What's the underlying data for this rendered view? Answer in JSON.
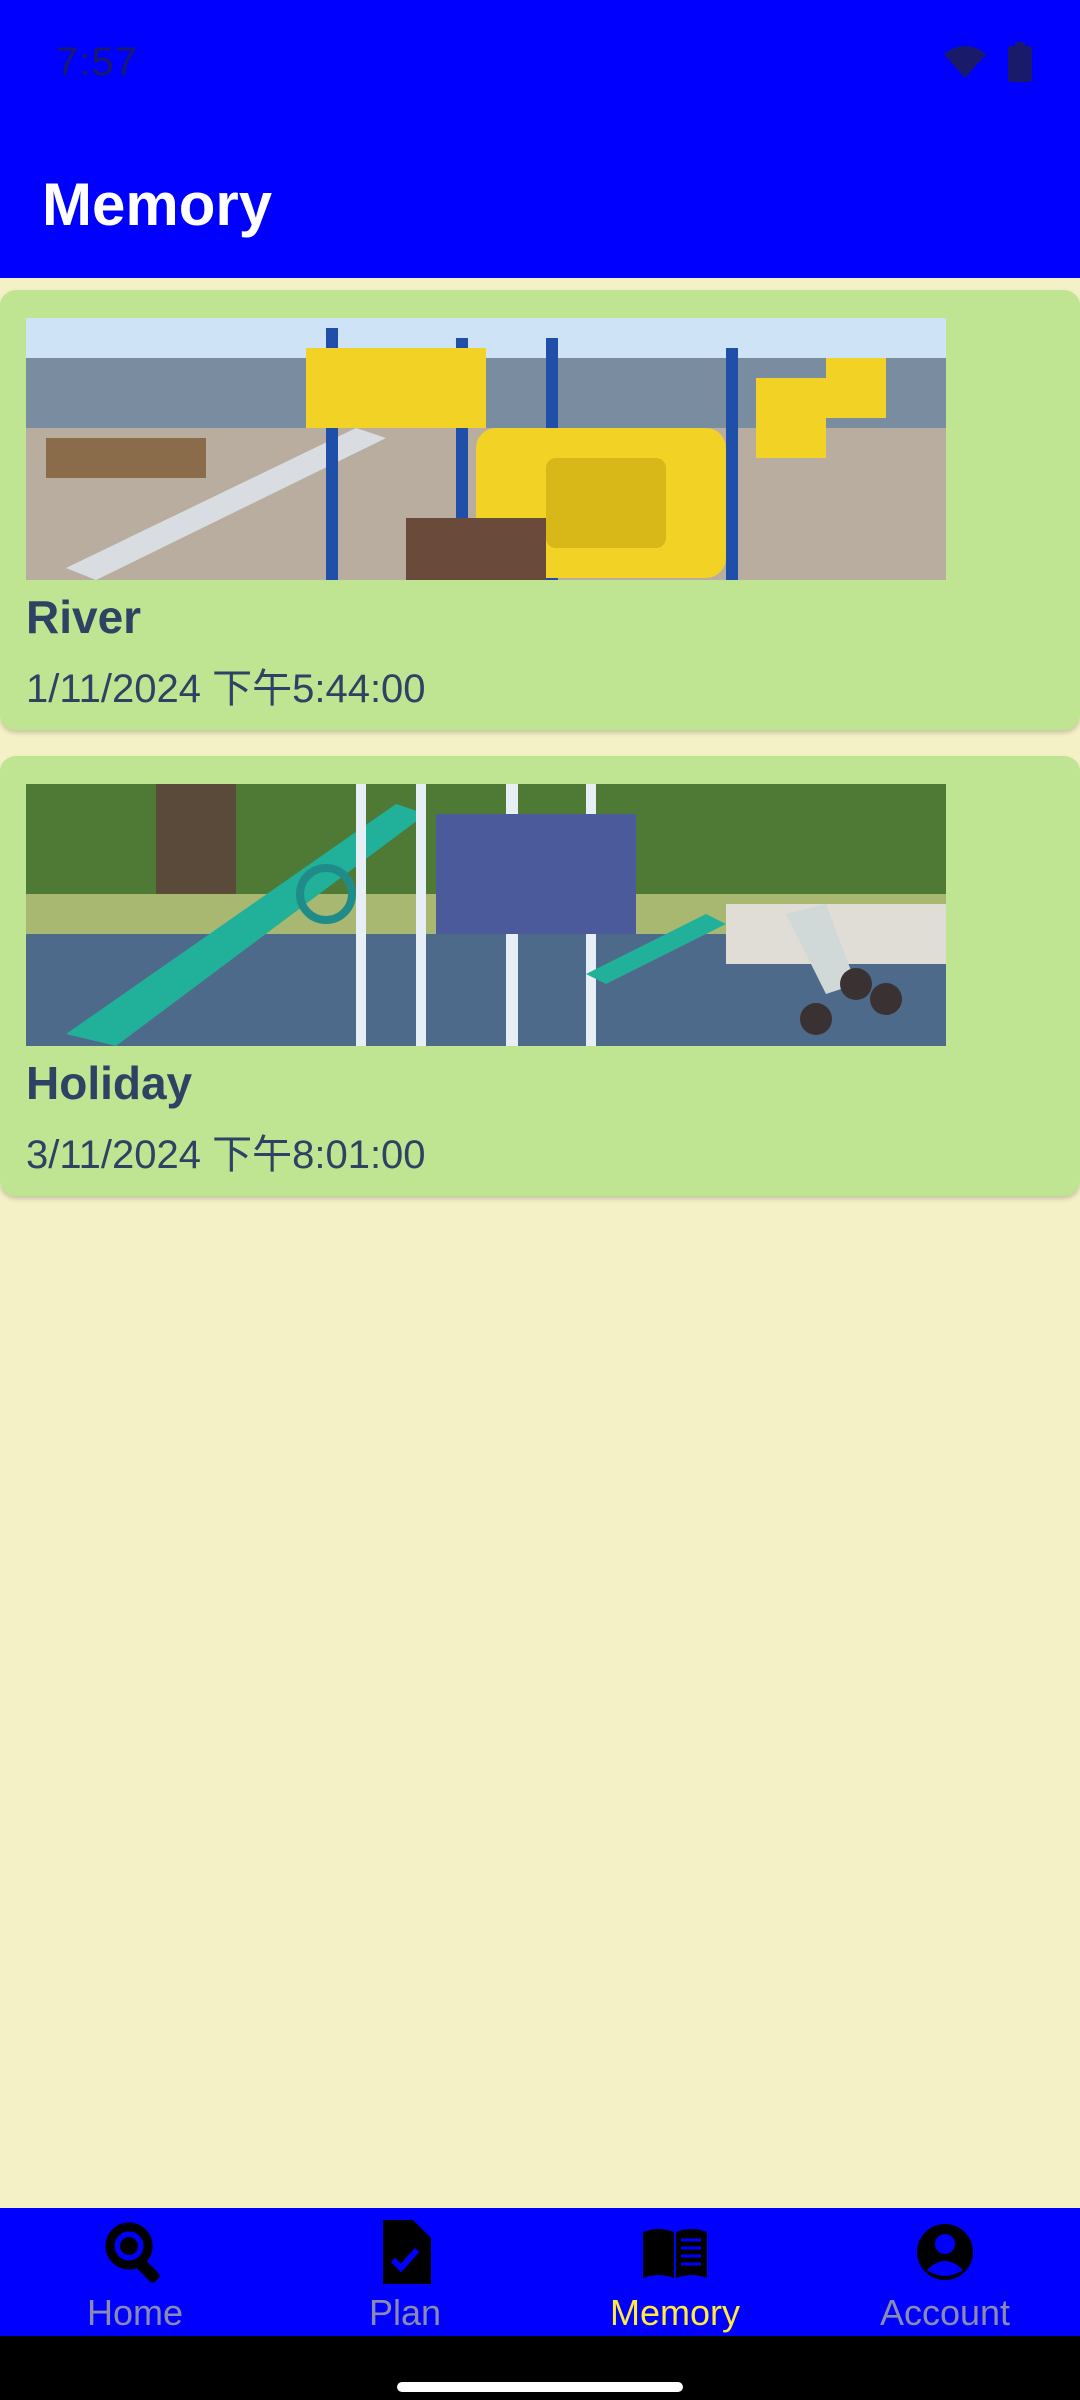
{
  "status": {
    "time": "7:57",
    "icons": [
      "wifi-icon",
      "battery-icon"
    ]
  },
  "header": {
    "title": "Memory"
  },
  "memories": [
    {
      "title": "River",
      "date": "1/11/2024 下午5:44:00",
      "image": "playground-photo-yellow-blue"
    },
    {
      "title": "Holiday",
      "date": "3/11/2024 下午8:01:00",
      "image": "playground-photo-teal-slide"
    }
  ],
  "nav": {
    "items": [
      {
        "label": "Home",
        "icon": "search-icon",
        "active": false
      },
      {
        "label": "Plan",
        "icon": "checklist-icon",
        "active": false
      },
      {
        "label": "Memory",
        "icon": "book-icon",
        "active": true
      },
      {
        "label": "Account",
        "icon": "account-icon",
        "active": false
      }
    ]
  },
  "colors": {
    "primary": "#0000FF",
    "background": "#F5F1C6",
    "card": "#BFE592",
    "text": "#2E4363",
    "nav_active": "#FFEB3B",
    "nav_inactive": "#8A8AB0"
  }
}
